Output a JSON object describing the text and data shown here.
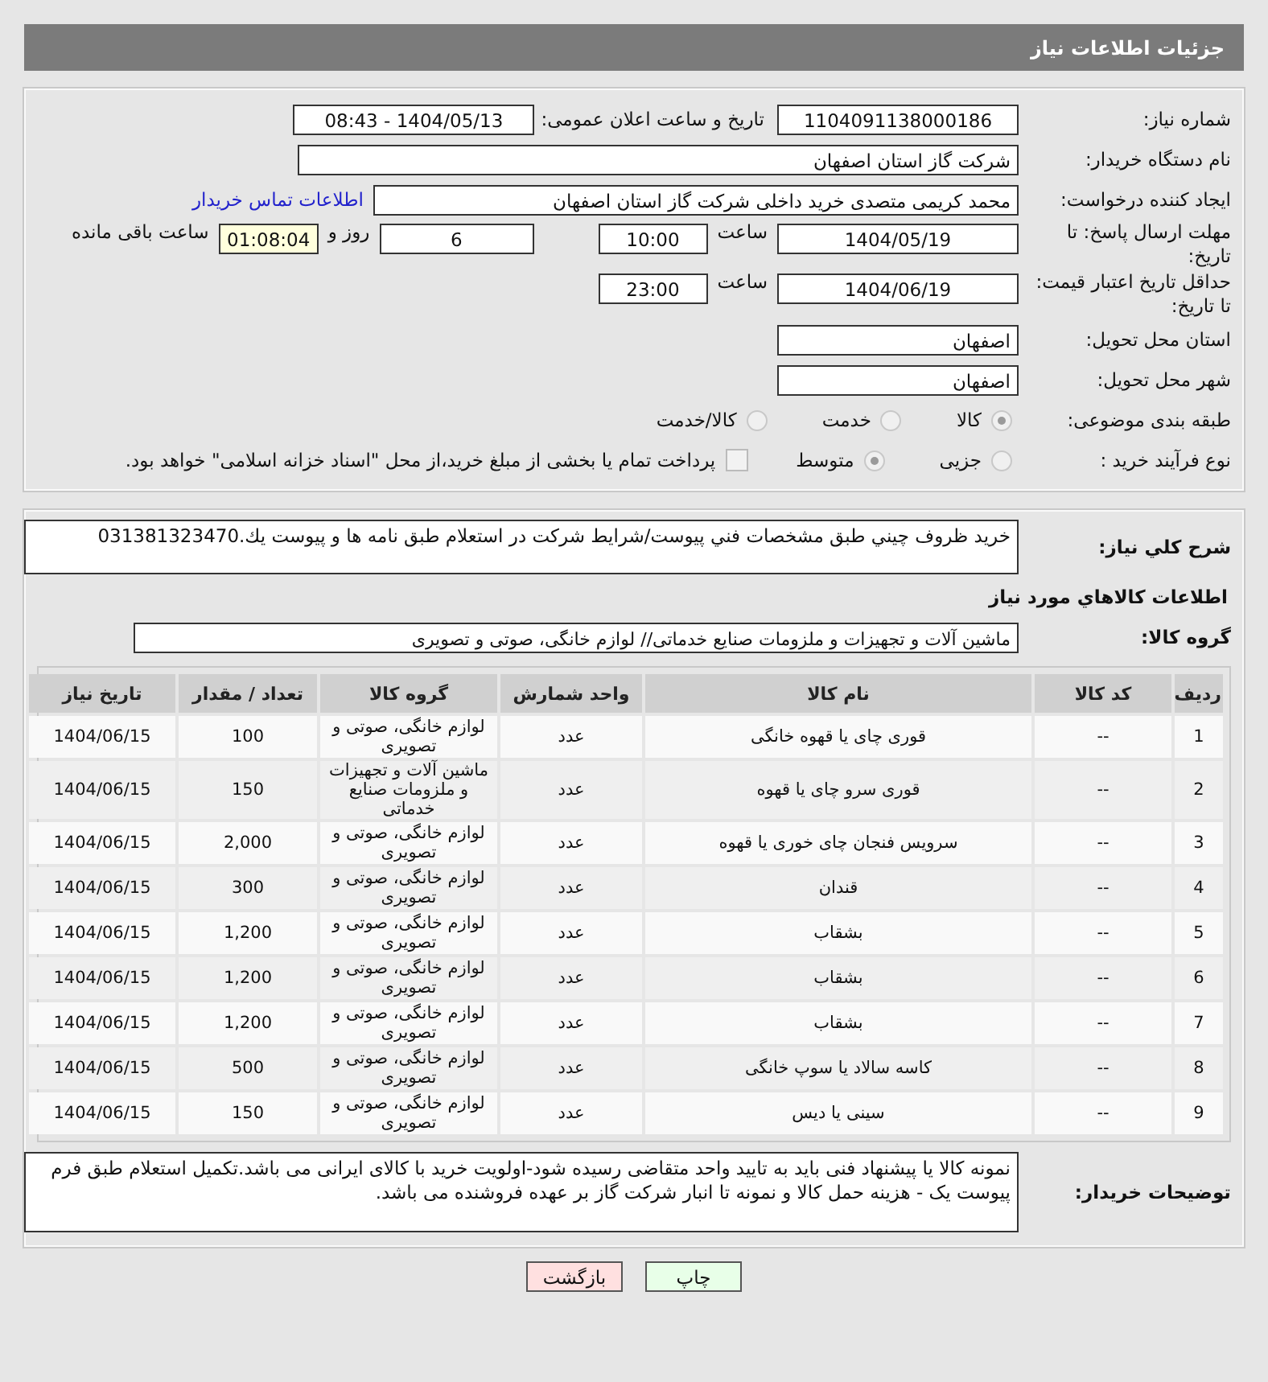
{
  "header": {
    "title": "جزئیات اطلاعات نیاز"
  },
  "need_number": {
    "label": "شماره نیاز:",
    "value": "1104091138000186"
  },
  "announce": {
    "label": "تاریخ و ساعت اعلان عمومی:",
    "value": "1404/05/13 - 08:43"
  },
  "buyer_org": {
    "label": "نام دستگاه خریدار:",
    "value": "شرکت گاز استان اصفهان"
  },
  "creator": {
    "label": "ایجاد کننده درخواست:",
    "value": "محمد کریمی متصدی خرید داخلی شرکت گاز استان اصفهان",
    "link": "اطلاعات تماس خریدار"
  },
  "deadline": {
    "label": "مهلت ارسال پاسخ: تا تاریخ:",
    "date": "1404/05/19",
    "time_label": "ساعت",
    "time": "10:00",
    "days": "6",
    "days_label": "روز و",
    "remaining": "01:08:04",
    "remaining_label": "ساعت باقی مانده"
  },
  "price_validity": {
    "label": "حداقل تاریخ اعتبار قیمت: تا تاریخ:",
    "date": "1404/06/19",
    "time_label": "ساعت",
    "time": "23:00"
  },
  "province": {
    "label": "استان محل تحویل:",
    "value": "اصفهان"
  },
  "city": {
    "label": "شهر محل تحویل:",
    "value": "اصفهان"
  },
  "subject_category": {
    "label": "طبقه بندی موضوعی:",
    "options": [
      {
        "label": "کالا",
        "selected": true
      },
      {
        "label": "خدمت",
        "selected": false
      },
      {
        "label": "کالا/خدمت",
        "selected": false
      }
    ]
  },
  "purchase_type": {
    "label": "نوع فرآیند خرید :",
    "options": [
      {
        "label": "جزیی",
        "selected": false
      },
      {
        "label": "متوسط",
        "selected": true
      }
    ],
    "payment": {
      "label": "پرداخت تمام یا بخشی از مبلغ خرید،از محل \"اسناد خزانه اسلامی\" خواهد بود.",
      "checked": false
    }
  },
  "description": {
    "label": "شرح کلي نياز:",
    "value": "خريد ظروف چيني طبق مشخصات فني پيوست/شرايط شركت در استعلام طبق نامه ها و پيوست يك.031381323470"
  },
  "goods_section": {
    "title": "اطلاعات كالاهاي مورد نياز"
  },
  "goods_group": {
    "label": "گروه کالا:",
    "value": "ماشین آلات و تجهیزات و ملزومات صنایع خدماتی// لوازم خانگی، صوتی و تصویری"
  },
  "table": {
    "columns": [
      "ردیف",
      "کد کالا",
      "نام کالا",
      "واحد شمارش",
      "گروه کالا",
      "تعداد / مقدار",
      "تاریخ نیاز"
    ],
    "rows": [
      [
        "1",
        "--",
        "قوری چای یا قهوه خانگی",
        "عدد",
        "لوازم خانگی، صوتی و تصویری",
        "100",
        "1404/06/15"
      ],
      [
        "2",
        "--",
        "قوری سرو چای یا قهوه",
        "عدد",
        "ماشین آلات و تجهیزات و ملزومات صنایع خدماتی",
        "150",
        "1404/06/15"
      ],
      [
        "3",
        "--",
        "سرویس فنجان چای خوری یا قهوه",
        "عدد",
        "لوازم خانگی، صوتی و تصویری",
        "2,000",
        "1404/06/15"
      ],
      [
        "4",
        "--",
        "قندان",
        "عدد",
        "لوازم خانگی، صوتی و تصویری",
        "300",
        "1404/06/15"
      ],
      [
        "5",
        "--",
        "بشقاب",
        "عدد",
        "لوازم خانگی، صوتی و تصویری",
        "1,200",
        "1404/06/15"
      ],
      [
        "6",
        "--",
        "بشقاب",
        "عدد",
        "لوازم خانگی، صوتی و تصویری",
        "1,200",
        "1404/06/15"
      ],
      [
        "7",
        "--",
        "بشقاب",
        "عدد",
        "لوازم خانگی، صوتی و تصویری",
        "1,200",
        "1404/06/15"
      ],
      [
        "8",
        "--",
        "کاسه سالاد یا سوپ خانگی",
        "عدد",
        "لوازم خانگی، صوتی و تصویری",
        "500",
        "1404/06/15"
      ],
      [
        "9",
        "--",
        "سینی یا دیس",
        "عدد",
        "لوازم خانگی، صوتی و تصویری",
        "150",
        "1404/06/15"
      ]
    ]
  },
  "buyer_notes": {
    "label": "توضیحات خریدار:",
    "value": "نمونه کالا یا پیشنهاد فنی باید به تایید واحد متقاضی رسیده شود-اولویت خرید با کالای ایرانی می باشد.تکمیل استعلام طبق فرم پیوست یک - هزینه حمل کالا و نمونه تا انبار شرکت گاز بر عهده فروشنده می باشد."
  },
  "buttons": [
    {
      "label": "چاپ",
      "kind": "print"
    },
    {
      "label": "بازگشت",
      "kind": "back"
    }
  ]
}
